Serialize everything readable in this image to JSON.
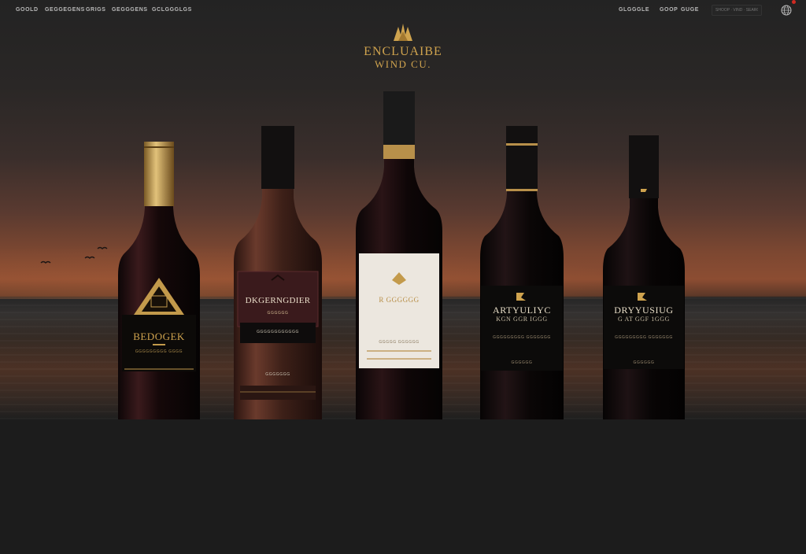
{
  "nav": {
    "left_links": [
      "GOOLD",
      "GEGGEGENS",
      "GRIGS",
      "GEGGGENS",
      "GCLGGGLGS"
    ],
    "right_links": [
      "GLGGGLE",
      "GOOP",
      "GUGE"
    ],
    "search_placeholder": "SHOOP · VIND · SEARCH"
  },
  "brand": {
    "line1": "ENCLUAIBE",
    "line2": "WIND CU."
  },
  "bottles": [
    {
      "label_title": "BEDOGEK",
      "label_sub": "GGGGGGGGG GGGG"
    },
    {
      "label_title": "DKGERNGDIER",
      "label_sub": "GGGGGG",
      "label_small": "GGGGGGGGGGGG",
      "label_foot": "GGGGGGG"
    },
    {
      "label_title": "R GGGGGG",
      "label_small": "GGGGG GGGGGG"
    },
    {
      "label_title": "ARTYULIYC",
      "label_sub": "KGN GGR IGGG",
      "label_small": "GGGGGGGGG GGGGGGG",
      "label_foot": "GGGGGG"
    },
    {
      "label_title": "DRYYUSIUG",
      "label_sub": "G AT GGF 1GGG",
      "label_small": "GGGGGGGGG GGGGGGG",
      "label_foot": "GGGGGG"
    }
  ],
  "colors": {
    "gold": "#cfa34e",
    "background": "#1c1c1c",
    "notification": "#d02a22"
  }
}
